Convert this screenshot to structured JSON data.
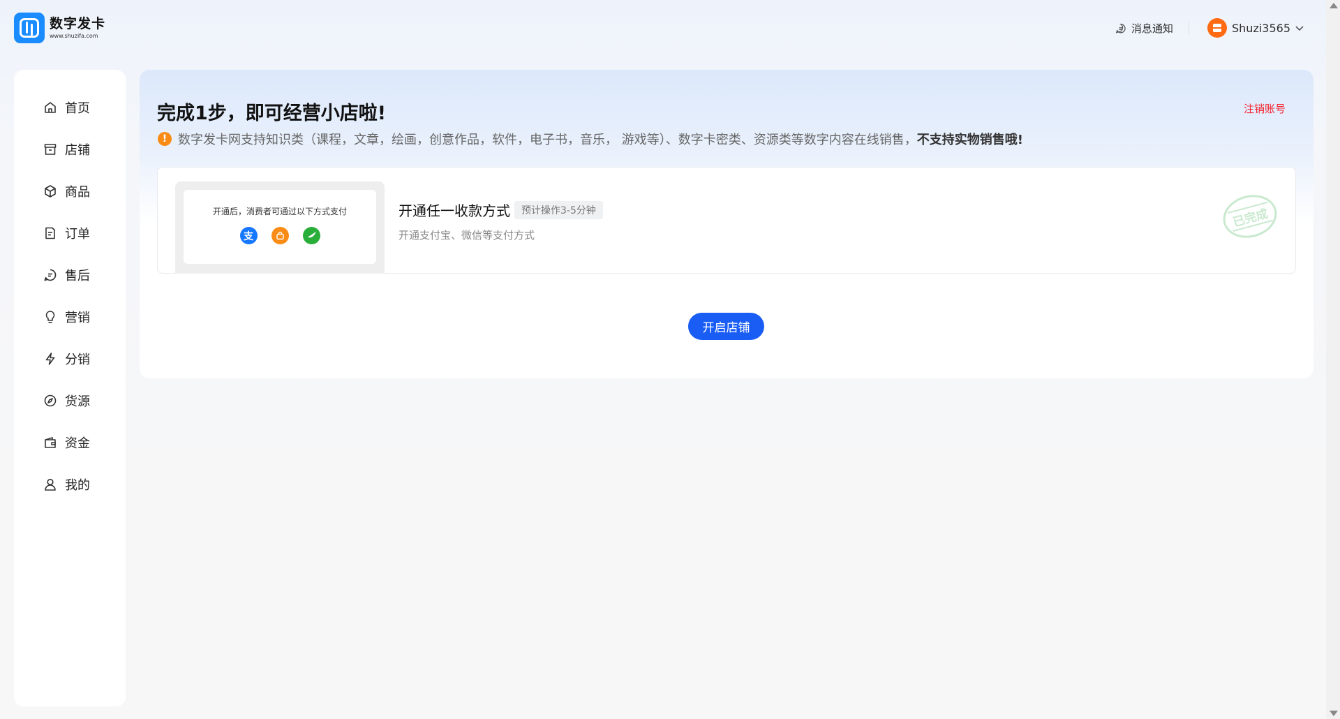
{
  "header": {
    "logo_name": "数字发卡",
    "logo_url": "www.shuzifa.com",
    "notify_label": "消息通知",
    "username": "Shuzi3565"
  },
  "sidebar": {
    "items": [
      {
        "label": "首页",
        "icon": "home-icon"
      },
      {
        "label": "店铺",
        "icon": "store-icon"
      },
      {
        "label": "商品",
        "icon": "box-icon"
      },
      {
        "label": "订单",
        "icon": "document-icon"
      },
      {
        "label": "售后",
        "icon": "chat-icon"
      },
      {
        "label": "营销",
        "icon": "lightbulb-icon"
      },
      {
        "label": "分销",
        "icon": "lightning-icon"
      },
      {
        "label": "货源",
        "icon": "compass-icon"
      },
      {
        "label": "资金",
        "icon": "wallet-icon"
      },
      {
        "label": "我的",
        "icon": "user-icon"
      }
    ]
  },
  "main": {
    "title": "完成1步，即可经营小店啦!",
    "cancel_link": "注销账号",
    "notice_text": "数字发卡网支持知识类（课程，文章，绘画，创意作品，软件，电子书，音乐， 游戏等）、数字卡密类、资源类等数字内容在线销售，",
    "notice_bold": "不支持实物销售哦!",
    "task": {
      "preview_text": "开通后，消费者可通过以下方式支付",
      "title": "开通任一收款方式",
      "tag": "预计操作3-5分钟",
      "desc": "开通支付宝、微信等支付方式",
      "stamp": "已完成"
    },
    "open_button": "开启店铺"
  },
  "colors": {
    "primary": "#1a5df5",
    "danger": "#f5222d",
    "warning": "#fa8c16",
    "alipay": "#1677ff",
    "wechat": "#2aae3a"
  }
}
